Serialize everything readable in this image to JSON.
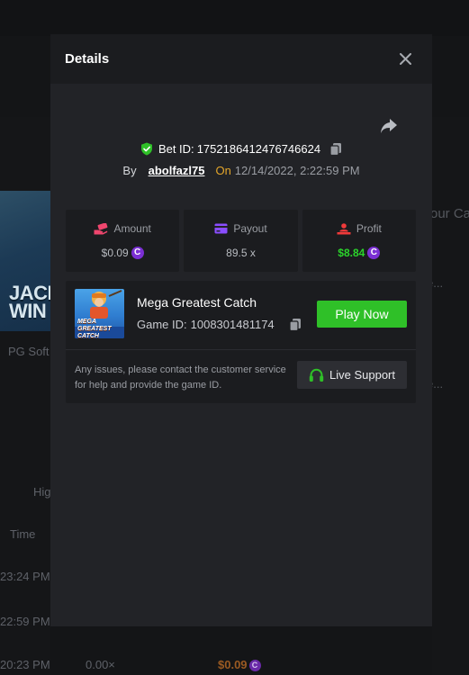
{
  "background": {
    "thumb_title": "JACK WIN",
    "provider": "PG Soft",
    "sort_label": "Hig",
    "time_header": "Time",
    "rows": [
      {
        "time": "23:24 PM"
      },
      {
        "time": "22:59 PM"
      },
      {
        "time": "20:23 PM",
        "multiplier": "0.00×",
        "win": "$0.09"
      }
    ],
    "right_header": "our Ca",
    "right_row_1": "e...",
    "right_row_2": "e..."
  },
  "modal": {
    "title": "Details",
    "bet_label": "Bet ID:",
    "bet_id": "1752186412476746624",
    "by_label": "By",
    "username": "abolfazl75",
    "on_label": "On",
    "date": "12/14/2022, 2:22:59 PM"
  },
  "stats": [
    {
      "label": "Amount",
      "value": "$0.09",
      "icon": "money-hand-icon",
      "color": "#f0466e"
    },
    {
      "label": "Payout",
      "value": "89.5 x",
      "icon": "card-icon",
      "color": "#8a4dff"
    },
    {
      "label": "Profit",
      "value": "$8.84",
      "icon": "person-profit-icon",
      "color": "#f03a3a"
    }
  ],
  "game": {
    "name": "Mega Greatest Catch",
    "id_label": "Game ID:",
    "id": "1008301481174",
    "thumb_title": "MEGA GREATEST CATCH",
    "play_label": "Play Now"
  },
  "support": {
    "text": "Any issues, please contact the customer service for help and provide the game ID.",
    "button_label": "Live Support"
  },
  "coin_symbol": "C",
  "colors": {
    "accent_green": "#2fc028",
    "profit_green": "#2bd42b",
    "coin_purple": "#7b2fd4",
    "on_label": "#e4a62a"
  }
}
